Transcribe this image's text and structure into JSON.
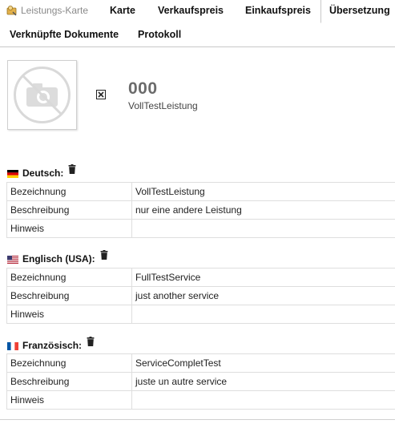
{
  "tabs": {
    "header_label": "Leistungs-Karte",
    "row1": [
      {
        "label": "Karte"
      },
      {
        "label": "Verkaufspreis"
      },
      {
        "label": "Einkaufspreis"
      },
      {
        "label": "Übersetzung",
        "active": true
      }
    ],
    "row2": [
      {
        "label": "Verknüpfte Dokumente"
      },
      {
        "label": "Protokoll"
      }
    ]
  },
  "item": {
    "number": "000",
    "name": "VollTestLeistung"
  },
  "translations": [
    {
      "language": "Deutsch:",
      "flag": "de",
      "rows": [
        {
          "key": "Bezeichnung",
          "value": "VollTestLeistung"
        },
        {
          "key": "Beschreibung",
          "value": "nur eine andere Leistung"
        },
        {
          "key": "Hinweis",
          "value": ""
        }
      ]
    },
    {
      "language": "Englisch (USA):",
      "flag": "us",
      "rows": [
        {
          "key": "Bezeichnung",
          "value": "FullTestService"
        },
        {
          "key": "Beschreibung",
          "value": "just another service"
        },
        {
          "key": "Hinweis",
          "value": ""
        }
      ]
    },
    {
      "language": "Französisch:",
      "flag": "fr",
      "rows": [
        {
          "key": "Bezeichnung",
          "value": "ServiceCompletTest"
        },
        {
          "key": "Beschreibung",
          "value": "juste un autre service"
        },
        {
          "key": "Hinweis",
          "value": ""
        }
      ]
    }
  ],
  "icons": {
    "header": "service-card-icon",
    "image_placeholder": "no-photo-icon",
    "remove": "close-box-icon",
    "delete": "trash-icon"
  },
  "colors": {
    "border": "#c8c8c8",
    "cell_border": "#dedede",
    "number": "#6b6b6b",
    "header_label": "#8a8a8a"
  }
}
